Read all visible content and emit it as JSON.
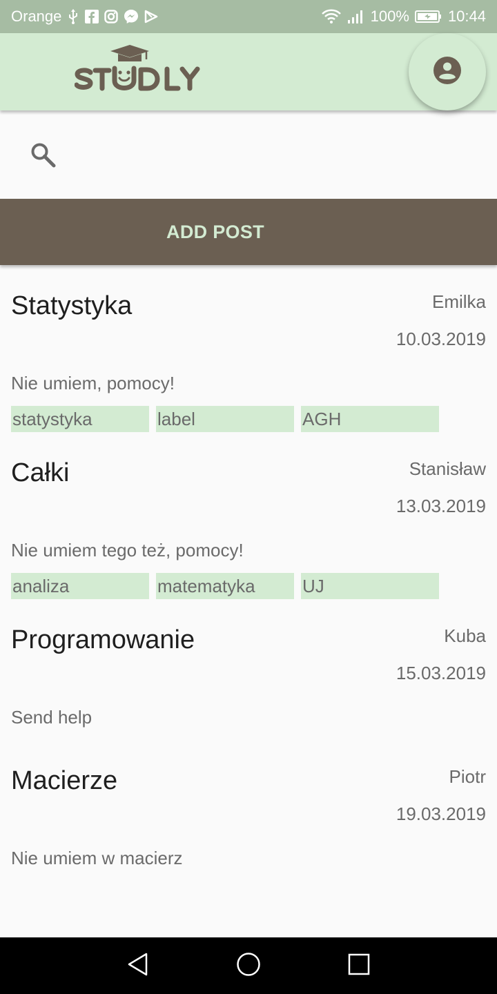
{
  "status_bar": {
    "carrier": "Orange",
    "battery": "100%",
    "time": "10:44"
  },
  "app_bar": {
    "logo_text": "STUDLY",
    "profile_icon": "account-circle-icon"
  },
  "search": {
    "icon": "search-icon",
    "value": "",
    "placeholder": ""
  },
  "add_post": {
    "label": "ADD POST"
  },
  "colors": {
    "status_bar": "#a6bca3",
    "app_bar": "#d3ebd2",
    "brand_brown": "#6b5f52",
    "tag_bg": "#d3ebd2"
  },
  "posts": [
    {
      "title": "Statystyka",
      "author": "Emilka",
      "date": "10.03.2019",
      "body": "Nie umiem, pomocy!",
      "tags": [
        "statystyka",
        "label",
        "AGH"
      ]
    },
    {
      "title": "Całki",
      "author": "Stanisław",
      "date": "13.03.2019",
      "body": "Nie umiem tego też, pomocy!",
      "tags": [
        "analiza",
        "matematyka",
        "UJ"
      ]
    },
    {
      "title": "Programowanie",
      "author": "Kuba",
      "date": "15.03.2019",
      "body": "Send help",
      "tags": []
    },
    {
      "title": "Macierze",
      "author": "Piotr",
      "date": "19.03.2019",
      "body": "Nie umiem w macierz",
      "tags": []
    }
  ],
  "nav_bar": {
    "back": "back-triangle-icon",
    "home": "home-circle-icon",
    "recents": "recents-square-icon"
  }
}
